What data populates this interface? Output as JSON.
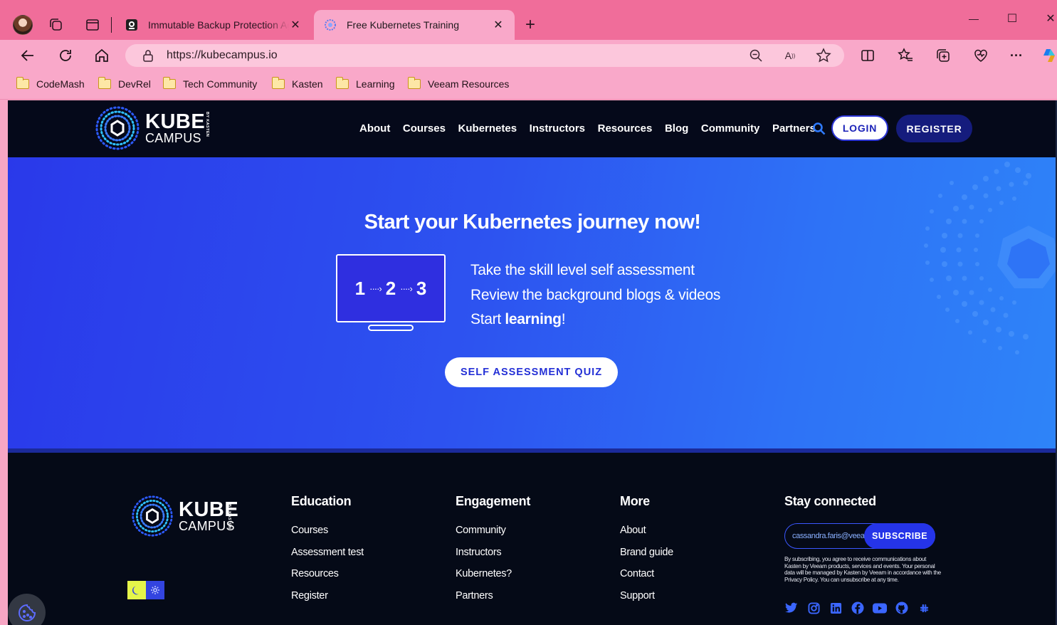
{
  "browser": {
    "tabs": [
      {
        "title": "Immutable Backup Protection Ag",
        "active": false
      },
      {
        "title": "Free Kubernetes Training",
        "active": true
      }
    ],
    "new_tab_glyph": "+",
    "close_glyph": "✕",
    "url": "https://kubecampus.io",
    "window_controls": {
      "minimize": "—",
      "maximize": "☐",
      "close": "✕"
    },
    "bookmarks": [
      "CodeMash",
      "DevRel",
      "Tech Community",
      "Kasten",
      "Learning",
      "Veeam Resources"
    ]
  },
  "site": {
    "logo": {
      "kube": "KUBE",
      "campus": "CAMPUS",
      "by": "BY KASTEN"
    },
    "nav": [
      "About",
      "Courses",
      "Kubernetes",
      "Instructors",
      "Resources",
      "Blog",
      "Community",
      "Partners"
    ],
    "login_label": "LOGIN",
    "register_label": "REGISTER"
  },
  "hero": {
    "title": "Start your Kubernetes journey now!",
    "monitor_steps": [
      "1",
      "2",
      "3"
    ],
    "monitor_arrow": "····›",
    "steps": {
      "line1": "Take the skill level self assessment",
      "line2": "Review the background blogs & videos",
      "line3_prefix": "Start ",
      "line3_bold": "learning",
      "line3_suffix": "!"
    },
    "cta_label": "SELF ASSESSMENT QUIZ"
  },
  "footer": {
    "columns": [
      {
        "heading": "Education",
        "links": [
          "Courses",
          "Assessment test",
          "Resources",
          "Register"
        ]
      },
      {
        "heading": "Engagement",
        "links": [
          "Community",
          "Instructors",
          "Kubernetes?",
          "Partners"
        ]
      },
      {
        "heading": "More",
        "links": [
          "About",
          "Brand guide",
          "Contact",
          "Support"
        ]
      }
    ],
    "stay_connected": {
      "heading": "Stay connected",
      "email_value": "cassandra.faris@veeam.com",
      "subscribe_label": "SUBSCRIBE",
      "fine_print": "By subscribing, you agree to receive communications about Kasten by Veeam products, services and events. Your personal data will be managed by Kasten by Veeam in accordance with the Privacy Policy. You can unsubscribe at any time."
    },
    "socials": [
      "twitter-icon",
      "instagram-icon",
      "linkedin-icon",
      "facebook-icon",
      "youtube-icon",
      "github-icon",
      "slack-icon"
    ]
  },
  "colors": {
    "chrome_tabbar": "#f06d9a",
    "chrome_toolbar": "#f9a8c9",
    "hero_start": "#2a39ea",
    "hero_end": "#2e84f8",
    "navbar_bg": "#05091a",
    "register_bg": "#151c7d",
    "accent_blue": "#2534e8"
  }
}
